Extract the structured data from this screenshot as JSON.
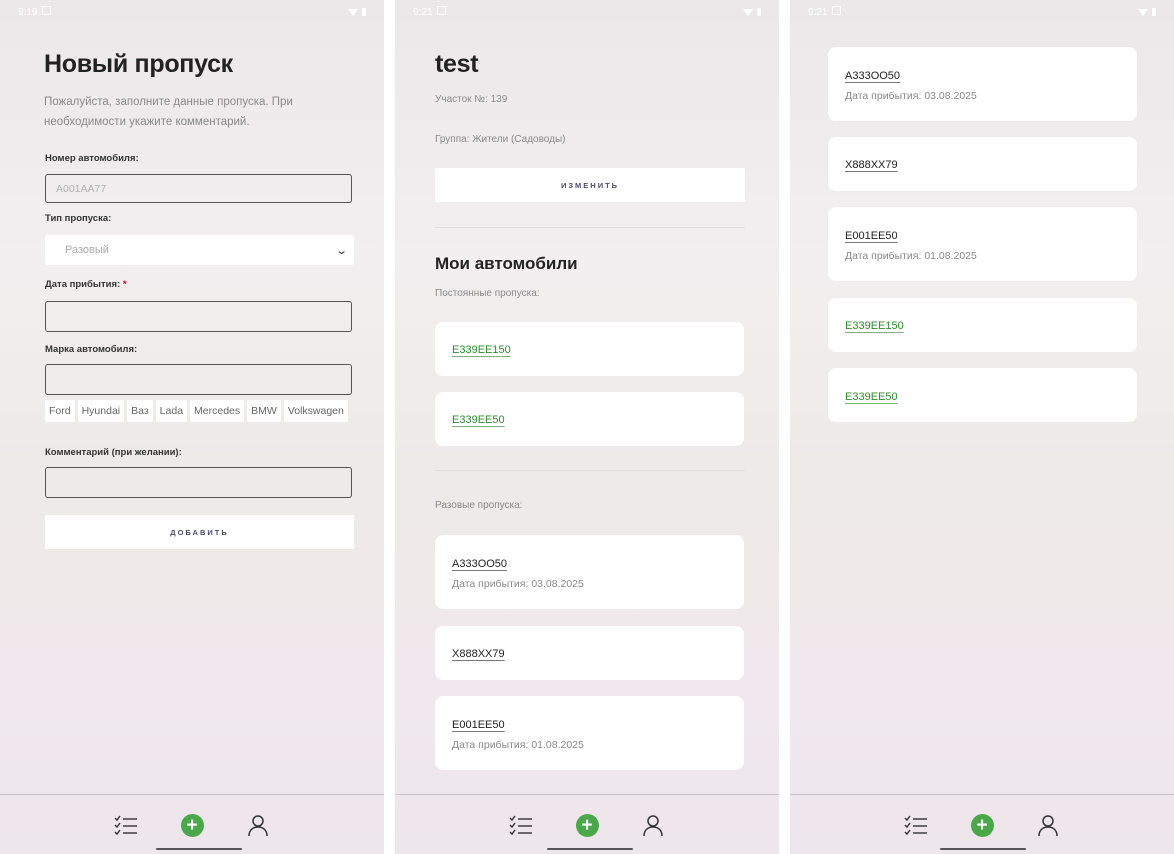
{
  "screen1": {
    "status_time": "9:19",
    "title": "Новый пропуск",
    "intro": "Пожалуйста, заполните данные пропуска. При необходимости укажите комментарий.",
    "car_number_label": "Номер автомобиля:",
    "car_number_placeholder": "А001АА77",
    "pass_type_label": "Тип пропуска:",
    "pass_type_value": "Разовый",
    "arrival_label": "Дата прибытия:",
    "required_mark": "*",
    "brand_label": "Марка автомобиля:",
    "brands": [
      "Ford",
      "Hyundai",
      "Ваз",
      "Lada",
      "Mercedes",
      "BMW",
      "Volkswagen"
    ],
    "comment_label": "Комментарий (при желании):",
    "add_button": "ДОБАВИТЬ"
  },
  "screen2": {
    "status_time": "9:21",
    "title": "test",
    "plot": "Участок №: 139",
    "group": "Группа: Жители (Садоводы)",
    "edit_button": "ИЗМЕНИТЬ",
    "cars_heading": "Мои автомобили",
    "permanent_label": "Постоянные пропуска:",
    "permanent": [
      "Е339ЕЕ150",
      "Е339ЕЕ50"
    ],
    "onetime_label": "Разовые пропуска:",
    "onetime": [
      {
        "plate": "А333ОО50",
        "arrival": "Дата прибытия: 03.08.2025"
      },
      {
        "plate": "Х888ХХ79",
        "arrival": ""
      },
      {
        "plate": "Е001ЕЕ50",
        "arrival": "Дата прибытия: 01.08.2025"
      }
    ]
  },
  "screen3": {
    "status_time": "9:21",
    "onetime": [
      {
        "plate": "А333ОО50",
        "arrival": "Дата прибытия: 03.08.2025"
      },
      {
        "plate": "Х888ХХ79",
        "arrival": ""
      },
      {
        "plate": "Е001ЕЕ50",
        "arrival": "Дата прибытия: 01.08.2025"
      }
    ],
    "permanent": [
      "Е339ЕЕ150",
      "Е339ЕЕ50"
    ]
  },
  "nav": {
    "items": [
      {
        "icon": "list-icon"
      },
      {
        "icon": "plus-circle-icon"
      },
      {
        "icon": "user-icon"
      }
    ]
  },
  "colors": {
    "accent_green": "#4aa84a",
    "plate_green": "#2e8b2e",
    "button_text": "#4c4a6a",
    "required_red": "#d0021b"
  }
}
